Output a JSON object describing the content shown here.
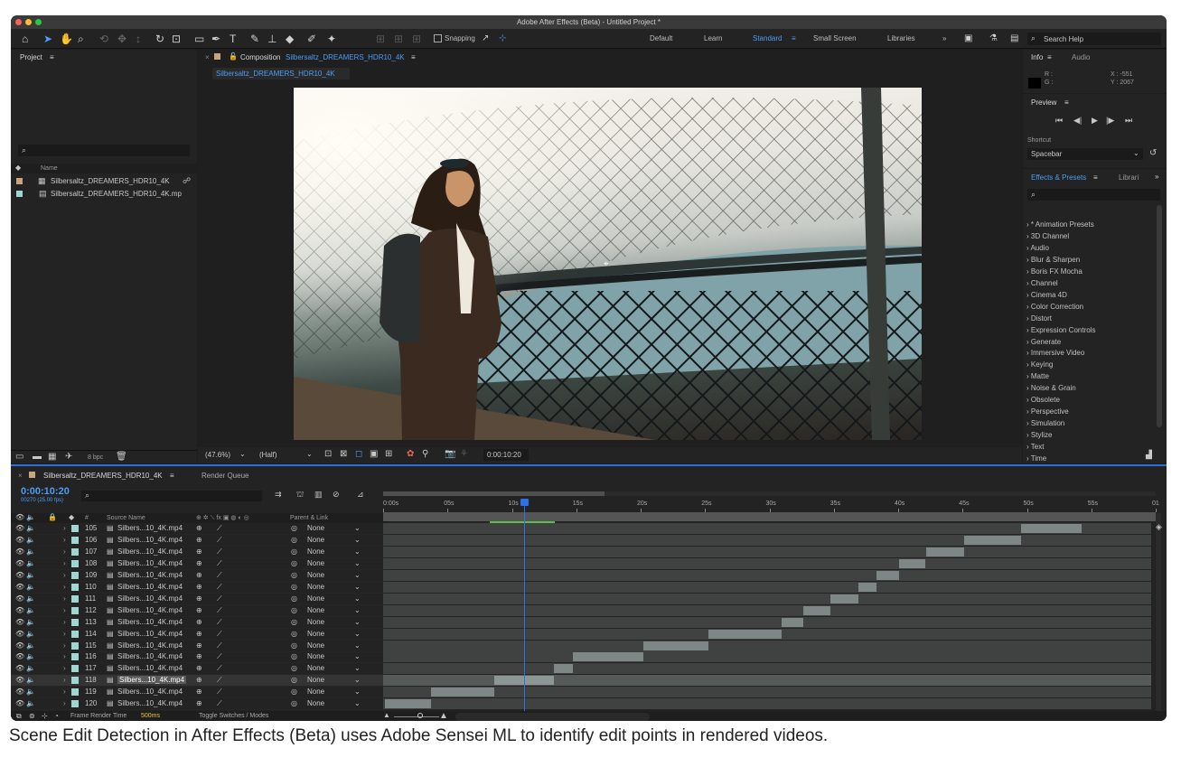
{
  "window": {
    "title": "Adobe After Effects (Beta) - Untitled Project *"
  },
  "toolbar": {
    "snapping": "Snapping",
    "workspaces": [
      "Default",
      "Learn",
      "Standard",
      "Small Screen",
      "Libraries"
    ],
    "search": "Search Help"
  },
  "project": {
    "title": "Project",
    "col_name": "Name",
    "items": [
      "Silbersaltz_DREAMERS_HDR10_4K",
      "Silbersaltz_DREAMERS_HDR10_4K.mp"
    ],
    "bpc": "8 bpc"
  },
  "composition": {
    "label": "Composition",
    "name": "Silbersaltz_DREAMERS_HDR10_4K",
    "tab": "Silbersaltz_DREAMERS_HDR10_4K",
    "zoom": "(47.6%)",
    "resolution": "(Half)",
    "timecode": "0:00:10:20"
  },
  "info": {
    "tab_info": "Info",
    "tab_audio": "Audio",
    "r": "R :",
    "g": "G :",
    "x": "X : -551",
    "y": "Y : 2067"
  },
  "preview": {
    "title": "Preview",
    "shortcut_label": "Shortcut",
    "shortcut": "Spacebar"
  },
  "effects": {
    "tab": "Effects & Presets",
    "tab2": "Librari",
    "items": [
      "* Animation Presets",
      "3D Channel",
      "Audio",
      "Blur & Sharpen",
      "Boris FX Mocha",
      "Channel",
      "Cinema 4D",
      "Color Correction",
      "Distort",
      "Expression Controls",
      "Generate",
      "Immersive Video",
      "Keying",
      "Matte",
      "Noise & Grain",
      "Obsolete",
      "Perspective",
      "Simulation",
      "Stylize",
      "Text",
      "Time"
    ]
  },
  "timeline": {
    "tab": "Silbersaltz_DREAMERS_HDR10_4K",
    "render_queue": "Render Queue",
    "timecode": "0:00:10:20",
    "fps": "00270 (25.00 fps)",
    "col_num": "#",
    "col_source": "Source Name",
    "col_parent": "Parent & Link",
    "frame_render_label": "Frame Render Time",
    "frame_render_value": "500ms",
    "toggle": "Toggle Switches / Modes",
    "ruler": [
      "0:00s",
      "05s",
      "10s",
      "15s",
      "20s",
      "25s",
      "30s",
      "35s",
      "40s",
      "45s",
      "50s",
      "55s",
      "01"
    ],
    "layers": [
      {
        "num": "105",
        "name": "Silbers...10_4K.mp4",
        "parent": "None",
        "start": 49.4,
        "end": 54.1
      },
      {
        "num": "106",
        "name": "Silbers...10_4K.mp4",
        "parent": "None",
        "start": 45.0,
        "end": 49.4
      },
      {
        "num": "107",
        "name": "Silbers...10_4K.mp4",
        "parent": "None",
        "start": 42.0,
        "end": 45.0
      },
      {
        "num": "108",
        "name": "Silbers...10_4K.mp4",
        "parent": "None",
        "start": 39.9,
        "end": 42.0
      },
      {
        "num": "109",
        "name": "Silbers...10_4K.mp4",
        "parent": "None",
        "start": 38.2,
        "end": 39.9
      },
      {
        "num": "110",
        "name": "Silbers...10_4K.mp4",
        "parent": "None",
        "start": 36.8,
        "end": 38.2
      },
      {
        "num": "111",
        "name": "Silbers...10_4K.mp4",
        "parent": "None",
        "start": 34.6,
        "end": 36.8
      },
      {
        "num": "112",
        "name": "Silbers...10_4K.mp4",
        "parent": "None",
        "start": 32.5,
        "end": 34.6
      },
      {
        "num": "113",
        "name": "Silbers...10_4K.mp4",
        "parent": "None",
        "start": 30.8,
        "end": 32.5
      },
      {
        "num": "114",
        "name": "Silbers...10_4K.mp4",
        "parent": "None",
        "start": 25.1,
        "end": 30.8
      },
      {
        "num": "115",
        "name": "Silbers...10_4K.mp4",
        "parent": "None",
        "start": 20.1,
        "end": 25.1
      },
      {
        "num": "116",
        "name": "Silbers...10_4K.mp4",
        "parent": "None",
        "start": 14.6,
        "end": 20.1
      },
      {
        "num": "117",
        "name": "Silbers...10_4K.mp4",
        "parent": "None",
        "start": 13.1,
        "end": 14.6
      },
      {
        "num": "118",
        "name": "Silbers...10_4K.mp4",
        "parent": "None",
        "start": 8.5,
        "end": 13.1
      },
      {
        "num": "119",
        "name": "Silbers...10_4K.mp4",
        "parent": "None",
        "start": 3.6,
        "end": 8.5
      },
      {
        "num": "120",
        "name": "Silbers...10_4K.mp4",
        "parent": "None",
        "start": 0.0,
        "end": 3.6
      }
    ]
  },
  "caption": "Scene Edit Detection in After Effects (Beta) uses Adobe Sensei ML to identify edit points in rendered videos."
}
